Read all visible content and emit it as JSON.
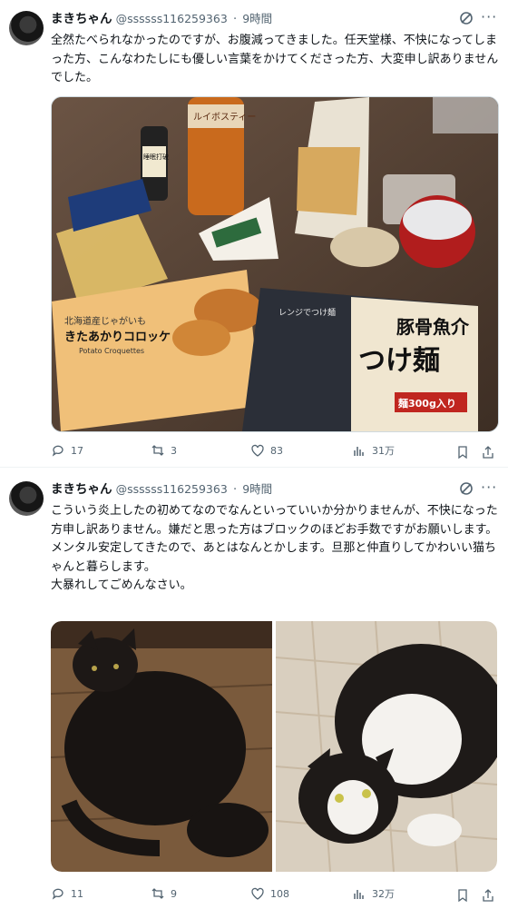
{
  "posts": [
    {
      "name": "まきちゃん",
      "handle": "@ssssss116259363",
      "time": "9時間",
      "text": [
        "全然たべられなかったのですが、お腹減ってきました。任天堂様、不快になってしまった方、こんなわたしにも優しい言葉をかけてくださった方、大変申し訳ありませんでした。"
      ],
      "media_labels": {
        "tea": "ルイボスティー",
        "sleep": "睡眠打破",
        "croquette_line1": "北海道産じゃがいも",
        "croquette_line2": "きたあかりコロッケ",
        "croquette_line3": "Potato Croquettes",
        "noodle_line1": "豚骨魚介",
        "noodle_line2": "つけ麺",
        "noodle_line3": "麺300g入り",
        "noodle_line4": "レンジでつけ麺"
      },
      "replies": "17",
      "reposts": "3",
      "likes": "83",
      "views": "31万"
    },
    {
      "name": "まきちゃん",
      "handle": "@ssssss116259363",
      "time": "9時間",
      "text": [
        "こういう炎上したの初めてなのでなんといっていいか分かりませんが、不快になった方申し訳ありません。嫌だと思った方はブロックのほどお手数ですがお願いします。",
        "メンタル安定してきたので、あとはなんとかします。旦那と仲直りしてかわいい猫ちゃんと暮らします。",
        "大暴れしてごめんなさい。"
      ],
      "replies": "11",
      "reposts": "9",
      "likes": "108",
      "views": "32万"
    }
  ],
  "colors": {
    "text": "#0f1419",
    "muted": "#536471",
    "border": "#eff3f4"
  },
  "icons": [
    "grok-icon",
    "more-icon",
    "reply-icon",
    "repost-icon",
    "like-icon",
    "views-icon",
    "bookmark-icon",
    "share-icon"
  ]
}
